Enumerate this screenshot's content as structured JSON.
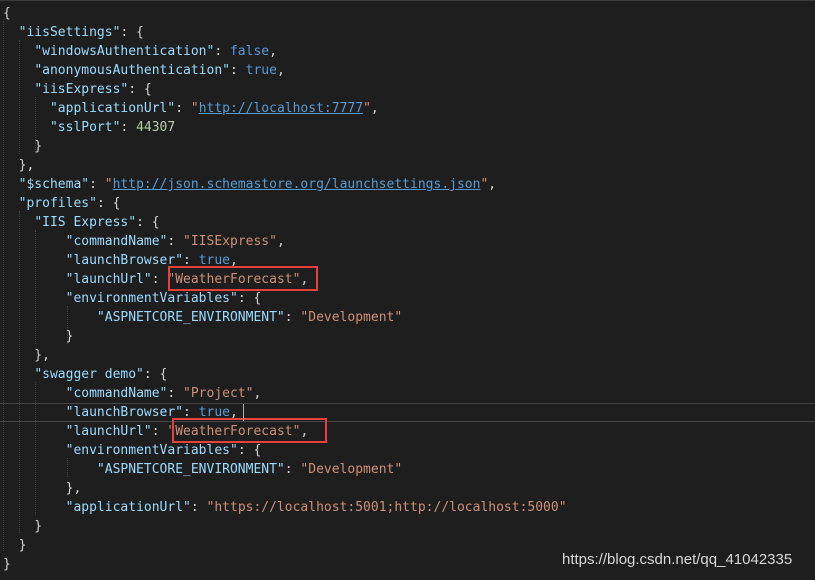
{
  "editor": {
    "lines": [
      {
        "segs": [
          {
            "t": "{",
            "c": "p"
          }
        ]
      },
      {
        "segs": [
          {
            "t": "  ",
            "c": "p"
          },
          {
            "t": "\"iisSettings\"",
            "c": "k"
          },
          {
            "t": ": {",
            "c": "p"
          }
        ]
      },
      {
        "segs": [
          {
            "t": "    ",
            "c": "p"
          },
          {
            "t": "\"windowsAuthentication\"",
            "c": "k"
          },
          {
            "t": ": ",
            "c": "p"
          },
          {
            "t": "false",
            "c": "b"
          },
          {
            "t": ",",
            "c": "p"
          }
        ]
      },
      {
        "segs": [
          {
            "t": "    ",
            "c": "p"
          },
          {
            "t": "\"anonymousAuthentication\"",
            "c": "k"
          },
          {
            "t": ": ",
            "c": "p"
          },
          {
            "t": "true",
            "c": "b"
          },
          {
            "t": ",",
            "c": "p"
          }
        ]
      },
      {
        "segs": [
          {
            "t": "    ",
            "c": "p"
          },
          {
            "t": "\"iisExpress\"",
            "c": "k"
          },
          {
            "t": ": {",
            "c": "p"
          }
        ]
      },
      {
        "segs": [
          {
            "t": "      ",
            "c": "p"
          },
          {
            "t": "\"applicationUrl\"",
            "c": "k"
          },
          {
            "t": ": ",
            "c": "p"
          },
          {
            "t": "\"",
            "c": "s"
          },
          {
            "t": "http://localhost:7777",
            "c": "u"
          },
          {
            "t": "\"",
            "c": "s"
          },
          {
            "t": ",",
            "c": "p"
          }
        ]
      },
      {
        "segs": [
          {
            "t": "      ",
            "c": "p"
          },
          {
            "t": "\"sslPort\"",
            "c": "k"
          },
          {
            "t": ": ",
            "c": "p"
          },
          {
            "t": "44307",
            "c": "n"
          }
        ]
      },
      {
        "segs": [
          {
            "t": "    }",
            "c": "p"
          }
        ]
      },
      {
        "segs": [
          {
            "t": "  },",
            "c": "p"
          }
        ]
      },
      {
        "segs": [
          {
            "t": "  ",
            "c": "p"
          },
          {
            "t": "\"$schema\"",
            "c": "k"
          },
          {
            "t": ": ",
            "c": "p"
          },
          {
            "t": "\"",
            "c": "s"
          },
          {
            "t": "http://json.schemastore.org/launchsettings.json",
            "c": "u"
          },
          {
            "t": "\"",
            "c": "s"
          },
          {
            "t": ",",
            "c": "p"
          }
        ]
      },
      {
        "segs": [
          {
            "t": "  ",
            "c": "p"
          },
          {
            "t": "\"profiles\"",
            "c": "k"
          },
          {
            "t": ": {",
            "c": "p"
          }
        ]
      },
      {
        "segs": [
          {
            "t": "    ",
            "c": "p"
          },
          {
            "t": "\"IIS Express\"",
            "c": "k"
          },
          {
            "t": ": {",
            "c": "p"
          }
        ]
      },
      {
        "segs": [
          {
            "t": "        ",
            "c": "p"
          },
          {
            "t": "\"commandName\"",
            "c": "k"
          },
          {
            "t": ": ",
            "c": "p"
          },
          {
            "t": "\"IISExpress\"",
            "c": "s"
          },
          {
            "t": ",",
            "c": "p"
          }
        ]
      },
      {
        "segs": [
          {
            "t": "        ",
            "c": "p"
          },
          {
            "t": "\"launchBrowser\"",
            "c": "k"
          },
          {
            "t": ": ",
            "c": "p"
          },
          {
            "t": "true",
            "c": "b"
          },
          {
            "t": ",",
            "c": "p"
          }
        ]
      },
      {
        "segs": [
          {
            "t": "        ",
            "c": "p"
          },
          {
            "t": "\"launchUrl\"",
            "c": "k"
          },
          {
            "t": ": ",
            "c": "p"
          },
          {
            "t": "\"WeatherForecast\"",
            "c": "s"
          },
          {
            "t": ",",
            "c": "p"
          }
        ]
      },
      {
        "segs": [
          {
            "t": "        ",
            "c": "p"
          },
          {
            "t": "\"environmentVariables\"",
            "c": "k"
          },
          {
            "t": ": {",
            "c": "p"
          }
        ]
      },
      {
        "segs": [
          {
            "t": "            ",
            "c": "p"
          },
          {
            "t": "\"ASPNETCORE_ENVIRONMENT\"",
            "c": "k"
          },
          {
            "t": ": ",
            "c": "p"
          },
          {
            "t": "\"Development\"",
            "c": "s"
          }
        ]
      },
      {
        "segs": [
          {
            "t": "        }",
            "c": "p"
          }
        ]
      },
      {
        "segs": [
          {
            "t": "    },",
            "c": "p"
          }
        ]
      },
      {
        "segs": [
          {
            "t": "    ",
            "c": "p"
          },
          {
            "t": "\"swagger demo\"",
            "c": "k"
          },
          {
            "t": ": {",
            "c": "p"
          }
        ]
      },
      {
        "segs": [
          {
            "t": "        ",
            "c": "p"
          },
          {
            "t": "\"commandName\"",
            "c": "k"
          },
          {
            "t": ": ",
            "c": "p"
          },
          {
            "t": "\"Project\"",
            "c": "s"
          },
          {
            "t": ",",
            "c": "p"
          }
        ]
      },
      {
        "segs": [
          {
            "t": "        ",
            "c": "p"
          },
          {
            "t": "\"launchBrowser\"",
            "c": "k"
          },
          {
            "t": ": ",
            "c": "p"
          },
          {
            "t": "true",
            "c": "b"
          },
          {
            "t": ",",
            "c": "p"
          }
        ],
        "current": true
      },
      {
        "segs": [
          {
            "t": "        ",
            "c": "p"
          },
          {
            "t": "\"launchUrl\"",
            "c": "k"
          },
          {
            "t": ": ",
            "c": "p"
          },
          {
            "t": "\"WeatherForecast\"",
            "c": "s"
          },
          {
            "t": ",",
            "c": "p"
          }
        ]
      },
      {
        "segs": [
          {
            "t": "        ",
            "c": "p"
          },
          {
            "t": "\"environmentVariables\"",
            "c": "k"
          },
          {
            "t": ": {",
            "c": "p"
          }
        ]
      },
      {
        "segs": [
          {
            "t": "            ",
            "c": "p"
          },
          {
            "t": "\"ASPNETCORE_ENVIRONMENT\"",
            "c": "k"
          },
          {
            "t": ": ",
            "c": "p"
          },
          {
            "t": "\"Development\"",
            "c": "s"
          }
        ]
      },
      {
        "segs": [
          {
            "t": "        },",
            "c": "p"
          }
        ]
      },
      {
        "segs": [
          {
            "t": "        ",
            "c": "p"
          },
          {
            "t": "\"applicationUrl\"",
            "c": "k"
          },
          {
            "t": ": ",
            "c": "p"
          },
          {
            "t": "\"https://localhost:5001;http://localhost:5000\"",
            "c": "s"
          }
        ]
      },
      {
        "segs": [
          {
            "t": "    }",
            "c": "p"
          }
        ]
      },
      {
        "segs": [
          {
            "t": "  }",
            "c": "p"
          }
        ]
      },
      {
        "segs": [
          {
            "t": "}",
            "c": "p"
          }
        ]
      }
    ]
  },
  "highlighted_values": [
    "\"WeatherForecast\",",
    "\"WeatherForecast\","
  ],
  "watermark": "https://blog.csdn.net/qq_41042335",
  "colors": {
    "background": "#1e1e1e",
    "property_key": "#9cdcfe",
    "string": "#ce9178",
    "keyword": "#569cd6",
    "number": "#b5cea8",
    "highlight_box": "#e8403a"
  }
}
